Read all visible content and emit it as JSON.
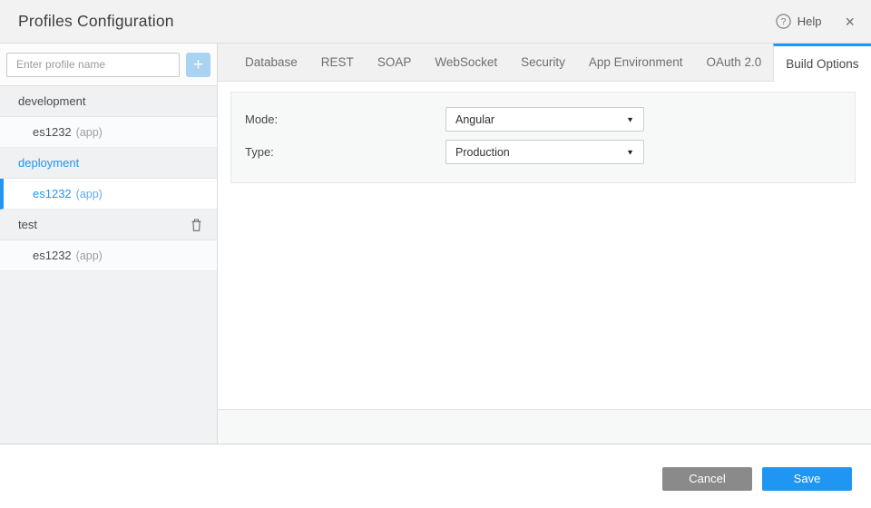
{
  "accent_color": "#2196f3",
  "header": {
    "title": "Profiles Configuration",
    "help_label": "Help"
  },
  "icons": {
    "help": "?",
    "close": "×",
    "add": "+",
    "dropdown_arrow": "▼"
  },
  "sidebar": {
    "profile_input_placeholder": "Enter profile name",
    "groups": [
      {
        "name": "development",
        "selected": false,
        "deletable": false,
        "children": [
          {
            "name": "es1232",
            "suffix": "(app)",
            "selected": false
          }
        ]
      },
      {
        "name": "deployment",
        "selected": true,
        "deletable": false,
        "children": [
          {
            "name": "es1232",
            "suffix": "(app)",
            "selected": true
          }
        ]
      },
      {
        "name": "test",
        "selected": false,
        "deletable": true,
        "children": [
          {
            "name": "es1232",
            "suffix": "(app)",
            "selected": false
          }
        ]
      }
    ]
  },
  "tabs": [
    {
      "label": "Database",
      "active": false
    },
    {
      "label": "REST",
      "active": false
    },
    {
      "label": "SOAP",
      "active": false
    },
    {
      "label": "WebSocket",
      "active": false
    },
    {
      "label": "Security",
      "active": false
    },
    {
      "label": "App Environment",
      "active": false
    },
    {
      "label": "OAuth 2.0",
      "active": false
    },
    {
      "label": "Build Options",
      "active": true
    }
  ],
  "build_options": {
    "mode_label": "Mode:",
    "mode_value": "Angular",
    "type_label": "Type:",
    "type_value": "Production"
  },
  "footer": {
    "cancel_label": "Cancel",
    "save_label": "Save"
  }
}
